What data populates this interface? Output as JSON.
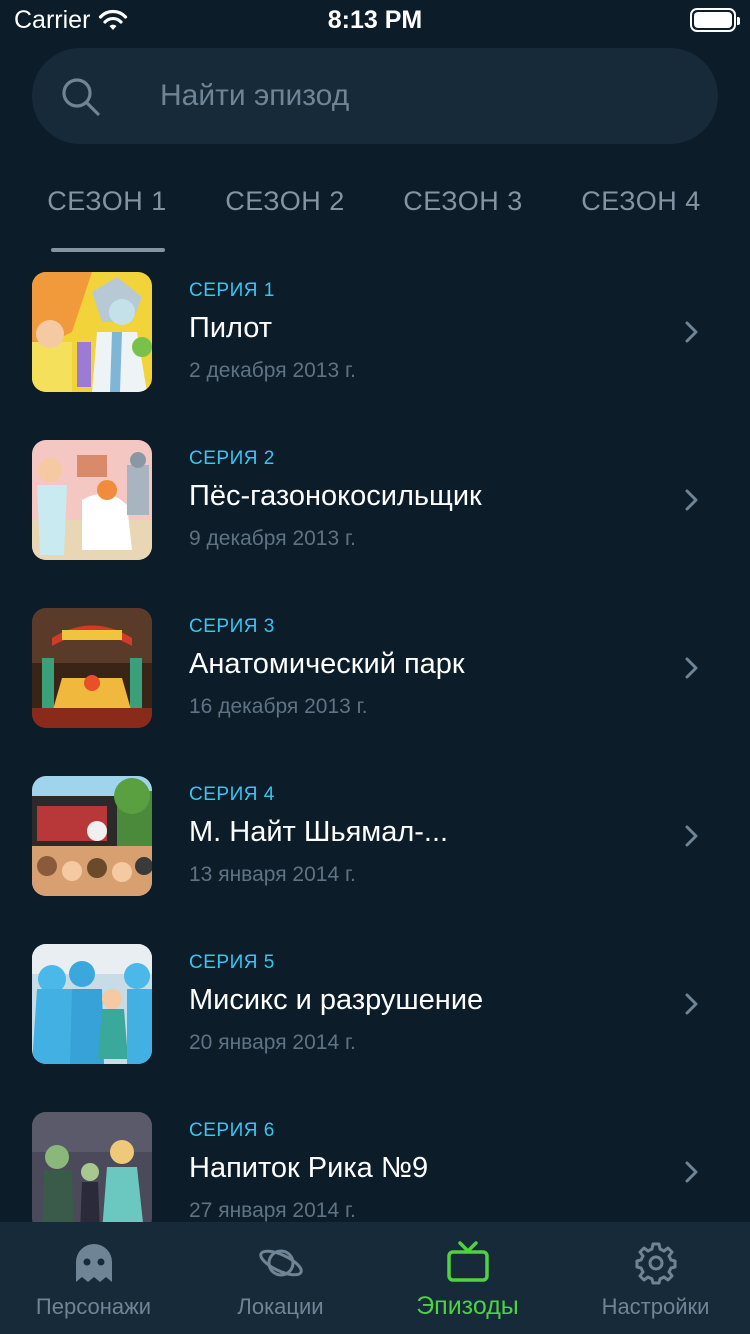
{
  "status_bar": {
    "carrier": "Carrier",
    "time": "8:13 PM"
  },
  "search": {
    "placeholder": "Найти эпизод"
  },
  "season_tabs": [
    {
      "label": "СЕЗОН 1",
      "selected": true
    },
    {
      "label": "СЕЗОН 2",
      "selected": false
    },
    {
      "label": "СЕЗОН 3",
      "selected": false
    },
    {
      "label": "СЕЗОН 4",
      "selected": false
    }
  ],
  "episodes": [
    {
      "number": "СЕРИЯ 1",
      "title": "Пилот",
      "date": "2 декабря 2013 г."
    },
    {
      "number": "СЕРИЯ 2",
      "title": "Пёс-газонокосильщик",
      "date": "9 декабря 2013 г."
    },
    {
      "number": "СЕРИЯ 3",
      "title": "Анатомический парк",
      "date": "16 декабря 2013 г."
    },
    {
      "number": "СЕРИЯ 4",
      "title": "М. Найт Шьямал-...",
      "date": "13 января 2014 г."
    },
    {
      "number": "СЕРИЯ 5",
      "title": "Мисикс и разрушение",
      "date": "20 января 2014 г."
    },
    {
      "number": "СЕРИЯ 6",
      "title": "Напиток Рика №9",
      "date": "27 января 2014 г."
    }
  ],
  "tabbar": [
    {
      "label": "Персонажи",
      "icon": "ghost-icon",
      "active": false
    },
    {
      "label": "Локации",
      "icon": "planet-icon",
      "active": false
    },
    {
      "label": "Эпизоды",
      "icon": "tv-icon",
      "active": true
    },
    {
      "label": "Настройки",
      "icon": "gear-icon",
      "active": false
    }
  ],
  "colors": {
    "background": "#0c1c29",
    "surface": "#162a3a",
    "accent_blue": "#37c6f0",
    "accent_green": "#4fd141",
    "muted_text": "#8394a3"
  }
}
